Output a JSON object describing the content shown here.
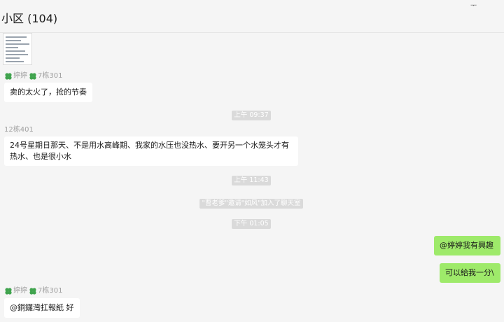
{
  "window": {
    "title": "小区 (104)",
    "pin_label": "ᅮ"
  },
  "colors": {
    "background": "#f5f5f5",
    "bubble_incoming": "#ffffff",
    "bubble_outgoing": "#9eea6a",
    "timestamp_bg": "#dadada",
    "sender_text": "#a0a0a0"
  },
  "messages": {
    "m1": {
      "sender": "婷婷",
      "sender_suffix": "7栋301",
      "text": "卖的太火了，抢的节奏"
    },
    "t1": "上午 09:37",
    "m2": {
      "sender": "12栋401",
      "text": "24号星期日那天、不是用水高峰期、我家的水压也没热水、要开另一个水笼头才有热水、也是很小水"
    },
    "t2": "上午 11:43",
    "system": "\"曹老爹\"邀请\"如风\"加入了聊天室",
    "t3": "下午 01:05",
    "m3": {
      "text": "@婷婷我有興趣"
    },
    "m4": {
      "text": "可以給我一分\\"
    },
    "m5": {
      "sender": "婷婷",
      "sender_suffix": "7栋301",
      "text": "@銅鑼灣扛報紙 好"
    }
  }
}
